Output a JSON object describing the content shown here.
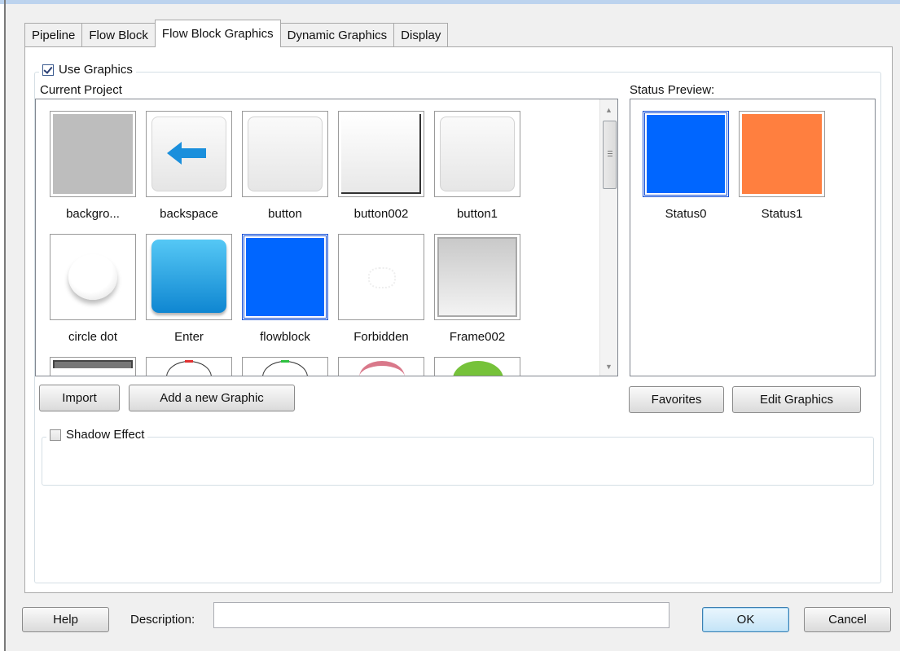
{
  "tabs": [
    "Pipeline",
    "Flow Block",
    "Flow Block Graphics",
    "Dynamic Graphics",
    "Display"
  ],
  "active_tab": "Flow Block Graphics",
  "use_graphics": {
    "label": "Use Graphics",
    "checked": true
  },
  "current_project_label": "Current Project",
  "status_preview_label": "Status Preview:",
  "gallery": {
    "items": [
      {
        "label": "backgro...",
        "icon": "gray-square-icon"
      },
      {
        "label": "backspace",
        "icon": "backspace-arrow-icon"
      },
      {
        "label": "button",
        "icon": "button-icon"
      },
      {
        "label": "button002",
        "icon": "button002-icon"
      },
      {
        "label": "button1",
        "icon": "button1-icon"
      },
      {
        "label": "circle dot",
        "icon": "circle-dot-icon"
      },
      {
        "label": "Enter",
        "icon": "enter-icon"
      },
      {
        "label": "flowblock",
        "icon": "flowblock-icon",
        "selected": true
      },
      {
        "label": "Forbidden",
        "icon": "forbidden-icon"
      },
      {
        "label": "Frame002",
        "icon": "frame-icon"
      }
    ]
  },
  "status_preview": [
    {
      "label": "Status0",
      "color": "#0066ff",
      "selected": true
    },
    {
      "label": "Status1",
      "color": "#ff7f3f"
    }
  ],
  "buttons": {
    "import": "Import",
    "add_graphic": "Add a new Graphic",
    "favorites": "Favorites",
    "edit_graphics": "Edit Graphics",
    "help": "Help",
    "ok": "OK",
    "cancel": "Cancel"
  },
  "shadow_effect": {
    "label": "Shadow Effect",
    "checked": false
  },
  "description": {
    "label": "Description:",
    "value": ""
  },
  "colors": {
    "accent": "#0066ff",
    "tab_border": "#a9a9a9"
  }
}
